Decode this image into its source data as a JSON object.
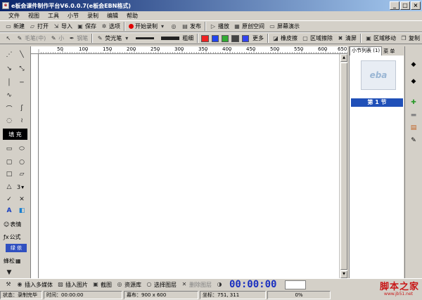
{
  "window": {
    "title": "e板会课件制作平台V6.0.0.7(e板会EBN格式)",
    "min": "_",
    "max": "□",
    "close": "×"
  },
  "menu": [
    "文件",
    "视图",
    "工具",
    "小节",
    "录制",
    "编辑",
    "帮助"
  ],
  "toolbar1": {
    "new": "新建",
    "open": "打开",
    "import": "导入",
    "save": "保存",
    "options": "选项",
    "start_record": "开始录制",
    "publish": "发布",
    "play": "播放",
    "original_space": "原创空间",
    "screen_demo": "屏幕演示"
  },
  "toolbar2": {
    "brush_mid": "毛笔(中)",
    "small": "小",
    "pen": "钢笔",
    "fluorescent": "荧光笔",
    "bold": "粗细",
    "more": "更多",
    "eraser": "橡皮擦",
    "area_erase": "区域擦除",
    "clear": "清屏",
    "area_move": "区域移动",
    "copy": "复制",
    "colors": [
      "#ee2222",
      "#2244ee",
      "#33aa33",
      "#444444",
      "#3344ee"
    ]
  },
  "leftpanel": {
    "fill": "填 充",
    "num": "3",
    "emoji": "表情",
    "formula": "公式",
    "blue": "绿 依",
    "cell": "蜂松"
  },
  "ruler_labels": [
    "50",
    "100",
    "150",
    "200",
    "250",
    "300",
    "350",
    "400",
    "450",
    "500",
    "550",
    "600",
    "650"
  ],
  "side": {
    "tab1": "小节列表 (1)",
    "tab2": "菜 单",
    "thumb_text": "eba",
    "section_label": "第 1 节"
  },
  "bottom": {
    "insert_media": "插入多媒体",
    "insert_image": "插入图片",
    "screenshot": "截图",
    "resources": "资源库",
    "select_layer": "选择图层",
    "delete_layer": "删除图层",
    "timer": "00:00:00"
  },
  "status": {
    "state": "状态：录制完毕",
    "time": "时间：00:00:00",
    "canvas": "幕布：900 x 600",
    "coords": "坐标：751, 311",
    "percent": "0%"
  },
  "watermark": {
    "main": "脚本之家",
    "url": "www.jb51.net"
  }
}
